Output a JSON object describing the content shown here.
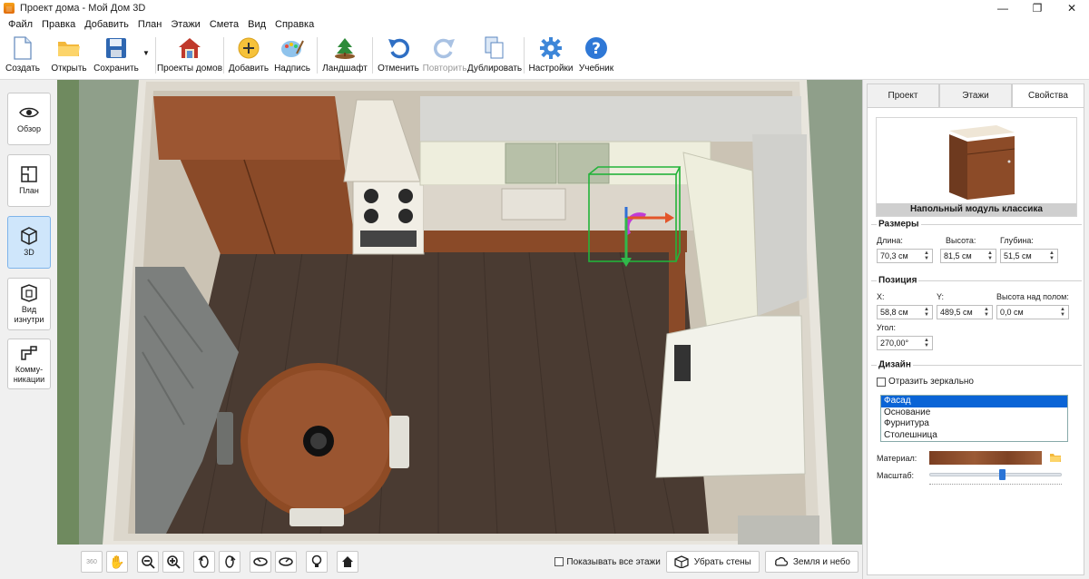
{
  "window": {
    "title": "Проект дома - Мой Дом 3D"
  },
  "menu": [
    "Файл",
    "Правка",
    "Добавить",
    "План",
    "Этажи",
    "Смета",
    "Вид",
    "Справка"
  ],
  "toolbar": {
    "create": "Создать",
    "open": "Открыть",
    "save": "Сохранить",
    "projects": "Проекты домов",
    "add": "Добавить",
    "label": "Надпись",
    "landscape": "Ландшафт",
    "undo": "Отменить",
    "redo": "Повторить",
    "duplicate": "Дублировать",
    "settings": "Настройки",
    "tutorial": "Учебник"
  },
  "sidebar": {
    "overview": "Обзор",
    "plan": "План",
    "view3d": "3D",
    "inside": "Вид изнутри",
    "utilities": "Комму-никации"
  },
  "bottom": {
    "rotate360": "360",
    "show_all_floors": "Показывать все этажи",
    "remove_walls": "Убрать стены",
    "earth_sky": "Земля и небо"
  },
  "panel": {
    "tabs": [
      "Проект",
      "Этажи",
      "Свойства"
    ],
    "active_tab": "Свойства",
    "preview_caption": "Напольный модуль классика",
    "sizes": {
      "title": "Размеры",
      "length_label": "Длина:",
      "length": "70,3 см",
      "height_label": "Высота:",
      "height": "81,5 см",
      "depth_label": "Глубина:",
      "depth": "51,5 см"
    },
    "position": {
      "title": "Позиция",
      "x_label": "X:",
      "x": "58,8 см",
      "y_label": "Y:",
      "y": "489,5 см",
      "elev_label": "Высота над полом:",
      "elev": "0,0 см",
      "angle_label": "Угол:",
      "angle": "270,00°"
    },
    "design": {
      "title": "Дизайн",
      "mirror_label": "Отразить зеркально",
      "parts": [
        "Фасад",
        "Основание",
        "Фурнитура",
        "Столешница"
      ],
      "selected_part": "Фасад",
      "material_label": "Материал:",
      "scale_label": "Масштаб:",
      "scale_value": 0.55
    }
  },
  "colors": {
    "accent": "#0a64d6",
    "wood": "#8a4a28",
    "floor": "#4a3b32"
  }
}
